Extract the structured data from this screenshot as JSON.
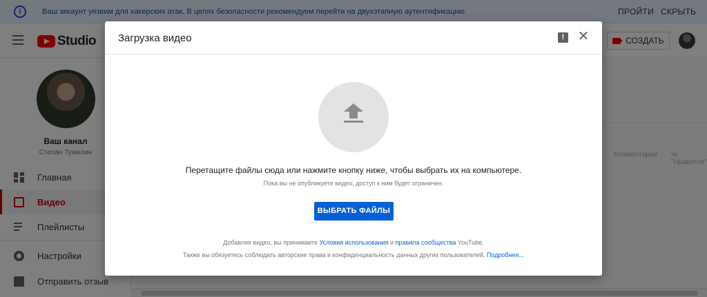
{
  "banner": {
    "icon": "info-icon",
    "text": "Ваш аккаунт уязвим для хакерских атак. В целях безопасности рекомендуем перейти на двухэтапную аутентификацию.",
    "login_label": "ПРОЙТИ",
    "hide_label": "СКРЫТЬ"
  },
  "header": {
    "logo_text": "Studio",
    "create_label": "СОЗДАТЬ"
  },
  "sidebar": {
    "channel_name": "Ваш канал",
    "channel_owner": "Степан Тужилин",
    "items": [
      {
        "label": "Главная",
        "icon": "dashboard-icon"
      },
      {
        "label": "Видео",
        "icon": "video-icon",
        "active": true
      },
      {
        "label": "Плейлисты",
        "icon": "playlist-icon"
      },
      {
        "label": "Настройки",
        "icon": "gear-icon"
      },
      {
        "label": "Отправить отзыв",
        "icon": "feedback-icon"
      }
    ]
  },
  "background": {
    "col_comments": "Комментарии",
    "col_likes": "% \"Нравится\""
  },
  "dialog": {
    "title": "Загрузка видео",
    "drop_text": "Перетащите файлы сюда или нажмите кнопку ниже, чтобы выбрать их на компьютере.",
    "note_text": "Пока вы не опубликуете видео, доступ к ним будет ограничен.",
    "select_label": "ВЫБРАТЬ ФАЙЛЫ",
    "terms_prefix": "Добавляя видео, вы принимаете",
    "terms_link": "Условия использования",
    "terms_and": "и",
    "community_link": "правила сообщества",
    "terms_suffix": "YouTube.",
    "rights_text": "Также вы обязуетесь соблюдать авторские права и конфиденциальность данных других пользователей.",
    "more_link": "Подробнее..."
  },
  "colors": {
    "accent_red": "#cc0000",
    "primary_blue": "#065fd4",
    "banner_bg": "#e8f0fe"
  }
}
